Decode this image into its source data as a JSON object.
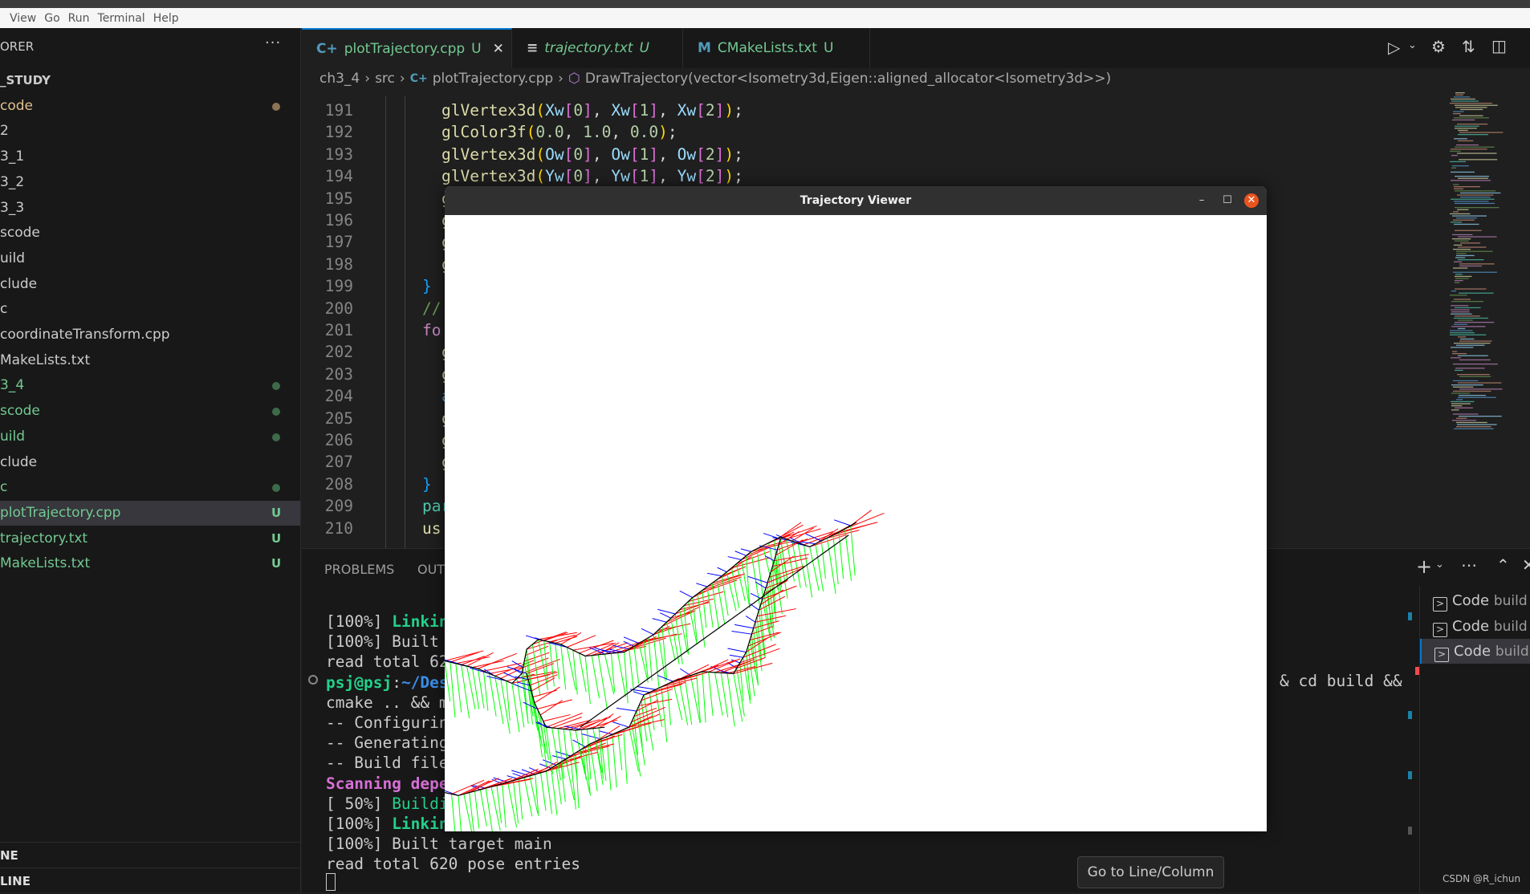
{
  "menu": [
    "View",
    "Go",
    "Run",
    "Terminal",
    "Help"
  ],
  "sidebar": {
    "header": "ORER",
    "more": "···",
    "items": [
      {
        "label": "_STUDY",
        "color": "#cccccc",
        "bold": true
      },
      {
        "label": "code",
        "color": "#e2c08d",
        "dot": "#8b7355"
      },
      {
        "label": "2",
        "color": "#cccccc"
      },
      {
        "label": "3_1",
        "color": "#cccccc"
      },
      {
        "label": "3_2",
        "color": "#cccccc"
      },
      {
        "label": "3_3",
        "color": "#cccccc"
      },
      {
        "label": "scode",
        "color": "#cccccc"
      },
      {
        "label": "uild",
        "color": "#cccccc"
      },
      {
        "label": "clude",
        "color": "#cccccc"
      },
      {
        "label": "c",
        "color": "#cccccc"
      },
      {
        "label": "coordinateTransform.cpp",
        "color": "#cccccc"
      },
      {
        "label": "MakeLists.txt",
        "color": "#cccccc"
      },
      {
        "label": "3_4",
        "color": "#73c991",
        "dot": "#3d6b4a"
      },
      {
        "label": "scode",
        "color": "#73c991",
        "dot": "#3d6b4a"
      },
      {
        "label": "uild",
        "color": "#73c991",
        "dot": "#3d6b4a"
      },
      {
        "label": "clude",
        "color": "#cccccc"
      },
      {
        "label": "c",
        "color": "#73c991",
        "dot": "#3d6b4a"
      },
      {
        "label": "plotTrajectory.cpp",
        "color": "#73c991",
        "badge": "U",
        "selected": true
      },
      {
        "label": "trajectory.txt",
        "color": "#73c991",
        "badge": "U"
      },
      {
        "label": "MakeLists.txt",
        "color": "#73c991",
        "badge": "U"
      }
    ],
    "sections": [
      "NE",
      "LINE"
    ]
  },
  "tabs": [
    {
      "icon": "C+",
      "label": "plotTrajectory.cpp",
      "badge": "U",
      "close": "✕",
      "active": true
    },
    {
      "icon": "≡",
      "label": "trajectory.txt",
      "badge": "U",
      "italic": true
    },
    {
      "icon": "M",
      "label": "CMakeLists.txt",
      "badge": "U"
    }
  ],
  "breadcrumb": {
    "parts": [
      "ch3_4",
      "src",
      "plotTrajectory.cpp",
      "DrawTrajectory(vector<Isometry3d,Eigen::aligned_allocator<Isometry3d>>)"
    ],
    "sep": "›"
  },
  "code": [
    {
      "n": "191",
      "indent": 2,
      "tokens": [
        [
          "glVertex3d",
          "fn"
        ],
        [
          "(",
          "p"
        ],
        [
          "Xw",
          "v"
        ],
        [
          "[",
          "b"
        ],
        [
          "0",
          "n"
        ],
        [
          "]",
          "b"
        ],
        [
          ", ",
          "t"
        ],
        [
          "Xw",
          "v"
        ],
        [
          "[",
          "b"
        ],
        [
          "1",
          "n"
        ],
        [
          "]",
          "b"
        ],
        [
          ", ",
          "t"
        ],
        [
          "Xw",
          "v"
        ],
        [
          "[",
          "b"
        ],
        [
          "2",
          "n"
        ],
        [
          "]",
          "b"
        ],
        [
          ")",
          "p"
        ],
        [
          ";",
          "t"
        ]
      ]
    },
    {
      "n": "192",
      "indent": 2,
      "tokens": [
        [
          "glColor3f",
          "fn"
        ],
        [
          "(",
          "p"
        ],
        [
          "0.0",
          "n"
        ],
        [
          ", ",
          "t"
        ],
        [
          "1.0",
          "n"
        ],
        [
          ", ",
          "t"
        ],
        [
          "0.0",
          "n"
        ],
        [
          ")",
          "p"
        ],
        [
          ";",
          "t"
        ]
      ]
    },
    {
      "n": "193",
      "indent": 2,
      "tokens": [
        [
          "glVertex3d",
          "fn"
        ],
        [
          "(",
          "p"
        ],
        [
          "Ow",
          "v"
        ],
        [
          "[",
          "b"
        ],
        [
          "0",
          "n"
        ],
        [
          "]",
          "b"
        ],
        [
          ", ",
          "t"
        ],
        [
          "Ow",
          "v"
        ],
        [
          "[",
          "b"
        ],
        [
          "1",
          "n"
        ],
        [
          "]",
          "b"
        ],
        [
          ", ",
          "t"
        ],
        [
          "Ow",
          "v"
        ],
        [
          "[",
          "b"
        ],
        [
          "2",
          "n"
        ],
        [
          "]",
          "b"
        ],
        [
          ")",
          "p"
        ],
        [
          ";",
          "t"
        ]
      ]
    },
    {
      "n": "194",
      "indent": 2,
      "tokens": [
        [
          "glVertex3d",
          "fn"
        ],
        [
          "(",
          "p"
        ],
        [
          "Yw",
          "v"
        ],
        [
          "[",
          "b"
        ],
        [
          "0",
          "n"
        ],
        [
          "]",
          "b"
        ],
        [
          ", ",
          "t"
        ],
        [
          "Yw",
          "v"
        ],
        [
          "[",
          "b"
        ],
        [
          "1",
          "n"
        ],
        [
          "]",
          "b"
        ],
        [
          ", ",
          "t"
        ],
        [
          "Yw",
          "v"
        ],
        [
          "[",
          "b"
        ],
        [
          "2",
          "n"
        ],
        [
          "]",
          "b"
        ],
        [
          ")",
          "p"
        ],
        [
          ";",
          "t"
        ]
      ]
    },
    {
      "n": "195",
      "indent": 2,
      "tokens": [
        [
          "g",
          "fn"
        ]
      ]
    },
    {
      "n": "196",
      "indent": 2,
      "tokens": [
        [
          "g",
          "fn"
        ]
      ]
    },
    {
      "n": "197",
      "indent": 2,
      "tokens": [
        [
          "g",
          "fn"
        ]
      ]
    },
    {
      "n": "198",
      "indent": 2,
      "tokens": [
        [
          "g",
          "fn"
        ]
      ]
    },
    {
      "n": "199",
      "indent": 1,
      "tokens": [
        [
          "}",
          "br"
        ]
      ]
    },
    {
      "n": "200",
      "indent": 1,
      "tokens": [
        [
          "//",
          "c"
        ]
      ]
    },
    {
      "n": "201",
      "indent": 1,
      "tokens": [
        [
          "fo",
          "kw"
        ]
      ]
    },
    {
      "n": "202",
      "indent": 2,
      "tokens": [
        [
          "g",
          "fn"
        ]
      ]
    },
    {
      "n": "203",
      "indent": 2,
      "tokens": [
        [
          "g",
          "fn"
        ]
      ]
    },
    {
      "n": "204",
      "indent": 2,
      "tokens": [
        [
          "a",
          "bl"
        ]
      ]
    },
    {
      "n": "205",
      "indent": 2,
      "tokens": [
        [
          "g",
          "fn"
        ]
      ]
    },
    {
      "n": "206",
      "indent": 2,
      "tokens": [
        [
          "g",
          "fn"
        ]
      ]
    },
    {
      "n": "207",
      "indent": 2,
      "tokens": [
        [
          "g",
          "fn"
        ]
      ]
    },
    {
      "n": "208",
      "indent": 1,
      "tokens": [
        [
          "}",
          "br"
        ]
      ]
    },
    {
      "n": "209",
      "indent": 1,
      "tokens": [
        [
          "par",
          "ty"
        ]
      ]
    },
    {
      "n": "210",
      "indent": 1,
      "tokens": [
        [
          "us",
          "fn"
        ]
      ]
    }
  ],
  "panel": {
    "tabs": [
      "PROBLEMS",
      "OUT"
    ],
    "terminal": [
      [
        [
          "[100%] ",
          ""
        ],
        [
          "Linkin",
          "g"
        ]
      ],
      [
        [
          "[100%] Built",
          ""
        ]
      ],
      [
        [
          "read total 62",
          ""
        ]
      ],
      [
        [
          "psj@psj",
          "g"
        ],
        [
          ":",
          ""
        ],
        [
          "~/Des",
          "bl"
        ]
      ],
      [
        [
          "cmake .. && m",
          ""
        ]
      ],
      [
        [
          "-- Configurin",
          ""
        ]
      ],
      [
        [
          "-- Generating",
          ""
        ]
      ],
      [
        [
          "-- Build file",
          ""
        ]
      ],
      [
        [
          "Scanning depe",
          "m"
        ]
      ],
      [
        [
          "[ 50%] ",
          ""
        ],
        [
          "Buildi",
          "g2"
        ]
      ],
      [
        [
          "[100%] ",
          ""
        ],
        [
          "Linkin",
          "g"
        ]
      ],
      [
        [
          "[100%] Built target main",
          ""
        ]
      ],
      [
        [
          "read total 620 pose entries",
          ""
        ]
      ]
    ],
    "prompt_tail": "& cd build &&",
    "terminals": [
      {
        "label": "Code",
        "sub": "build"
      },
      {
        "label": "Code",
        "sub": "build"
      },
      {
        "label": "Code",
        "sub": "build",
        "selected": true
      }
    ]
  },
  "viewer": {
    "title": "Trajectory Viewer",
    "minimize": "–",
    "maximize": "☐",
    "close": "✕",
    "axis_colors": {
      "x": "#ff0000",
      "y": "#00ff00",
      "z": "#0000ff",
      "path": "#000000"
    }
  },
  "tooltip": "Go to Line/Column",
  "watermark": "CSDN @R_ichun"
}
